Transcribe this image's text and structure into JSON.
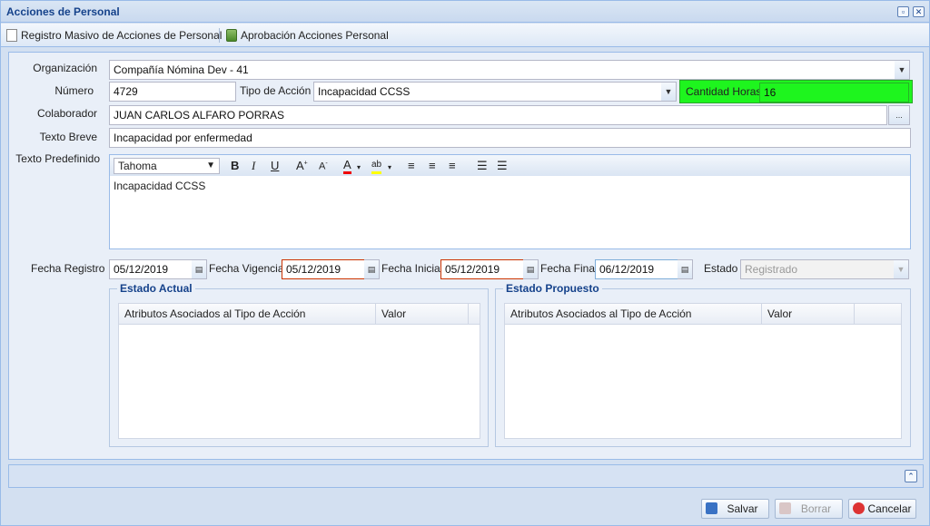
{
  "window": {
    "title": "Acciones de Personal"
  },
  "toolbar": {
    "bulk_label": "Registro Masivo de Acciones de Personal",
    "approval_label": "Aprobación Acciones Personal"
  },
  "form": {
    "organizacion_label": "Organización",
    "organizacion_value": "Compañía Nómina Dev - 41",
    "numero_label": "Número",
    "numero_value": "4729",
    "tipo_label": "Tipo de Acción",
    "tipo_value": "Incapacidad CCSS",
    "horas_label": "Cantidad Horas",
    "horas_value": "16",
    "colaborador_label": "Colaborador",
    "colaborador_value": "JUAN CARLOS ALFARO PORRAS",
    "colaborador_btn": "...",
    "texto_breve_label": "Texto Breve",
    "texto_breve_value": "Incapacidad por enfermedad",
    "texto_pred_label": "Texto Predefinido",
    "editor_font": "Tahoma",
    "editor_content": "Incapacidad CCSS",
    "fecha_registro_label": "Fecha Registro",
    "fecha_registro_value": "05/12/2019",
    "fecha_vigencia_label": "Fecha Vigencia",
    "fecha_vigencia_value": "05/12/2019",
    "fecha_inicial_label": "Fecha Inicial",
    "fecha_inicial_value": "05/12/2019",
    "fecha_final_label": "Fecha Final",
    "fecha_final_value": "06/12/2019",
    "estado_label": "Estado",
    "estado_value": "Registrado"
  },
  "estado_actual": {
    "legend": "Estado Actual",
    "col1": "Atributos Asociados al Tipo de Acción",
    "col2": "Valor"
  },
  "estado_propuesto": {
    "legend": "Estado Propuesto",
    "col1": "Atributos Asociados al Tipo de Acción",
    "col2": "Valor"
  },
  "buttons": {
    "save": "Salvar",
    "delete": "Borrar",
    "cancel": "Cancelar"
  },
  "colors": {
    "accent": "#15428b",
    "highlight": "#1ef51e"
  }
}
